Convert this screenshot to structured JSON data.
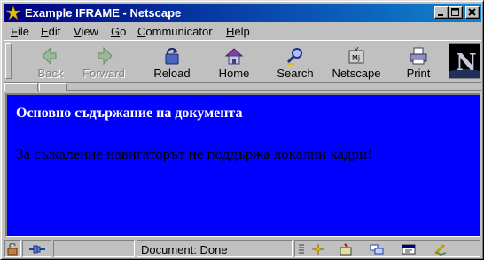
{
  "window": {
    "title": "Example IFRAME - Netscape",
    "controls": [
      "minimize",
      "maximize",
      "close"
    ]
  },
  "menubar": {
    "items": [
      {
        "label": "File",
        "accel": "F",
        "rest": "ile"
      },
      {
        "label": "Edit",
        "accel": "E",
        "rest": "dit"
      },
      {
        "label": "View",
        "accel": "V",
        "rest": "iew"
      },
      {
        "label": "Go",
        "accel": "G",
        "rest": "o"
      },
      {
        "label": "Communicator",
        "accel": "C",
        "rest": "ommunicator"
      },
      {
        "label": "Help",
        "accel": "H",
        "rest": "elp"
      }
    ]
  },
  "toolbar": {
    "buttons": [
      {
        "label": "Back",
        "icon": "back-arrow-icon",
        "enabled": false
      },
      {
        "label": "Forward",
        "icon": "forward-arrow-icon",
        "enabled": false
      },
      {
        "label": "Reload",
        "icon": "reload-icon",
        "enabled": true
      },
      {
        "label": "Home",
        "icon": "home-icon",
        "enabled": true
      },
      {
        "label": "Search",
        "icon": "search-icon",
        "enabled": true
      },
      {
        "label": "Netscape",
        "icon": "netscape-icon",
        "enabled": true
      },
      {
        "label": "Print",
        "icon": "print-icon",
        "enabled": true
      }
    ],
    "logo": "N"
  },
  "content": {
    "background": "#0000ff",
    "heading": "Основно съдържание на документа",
    "message": "За съжаление навигаторът не поддържа локални кадри!"
  },
  "statusbar": {
    "text": "Document: Done",
    "icons": [
      "security-lock-icon",
      "connection-icon",
      "component-bar-navigator-icon",
      "mail-icon",
      "discussion-icon",
      "composer-icon",
      "address-book-icon"
    ]
  }
}
